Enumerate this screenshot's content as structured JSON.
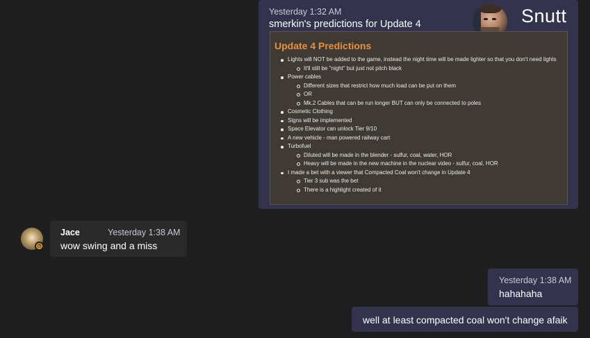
{
  "messages": {
    "main": {
      "timestamp": "Yesterday 1:32 AM",
      "text": "smerkin's predictions for Update 4",
      "image_caption": "Snutt",
      "card": {
        "title": "Update 4 Predictions",
        "items": [
          {
            "level": 1,
            "text": "Lights will NOT be added to the game, instead the night time will be made lighter so that you don't need lights"
          },
          {
            "level": 2,
            "text": "It'll still be \"night\" but just not pitch black"
          },
          {
            "level": 1,
            "text": "Power cables"
          },
          {
            "level": 2,
            "text": "Different sizes that restrict how much load can be put on them"
          },
          {
            "level": 2,
            "text": "OR"
          },
          {
            "level": 2,
            "text": "Mk.2 Cables that can be run longer BUT can only be connected to poles"
          },
          {
            "level": 1,
            "text": "Cosmetic Clothing"
          },
          {
            "level": 1,
            "text": "Signs will be implemented"
          },
          {
            "level": 1,
            "text": "Space Elevator can unlock Tier 9/10"
          },
          {
            "level": 1,
            "text": "A new vehicle - man powered railway cart"
          },
          {
            "level": 1,
            "text": "Turbofuel"
          },
          {
            "level": 2,
            "text": "Diluted will be made in the blender - sulfur, coal, water, HOR"
          },
          {
            "level": 2,
            "text": "Heavy will be made in the new machine in the nuclear video - sulfur, coal, HOR"
          },
          {
            "level": 1,
            "text": "I made a bet with a viewer that Compacted Coal won't change in Update 4"
          },
          {
            "level": 2,
            "text": "Tier 3 sub was the bet"
          },
          {
            "level": 2,
            "text": "There is a highlight created of it"
          }
        ]
      }
    },
    "jace": {
      "name": "Jace",
      "timestamp": "Yesterday 1:38 AM",
      "text": "wow swing and a miss"
    },
    "ha": {
      "timestamp": "Yesterday 1:38 AM",
      "text": "hahahaha"
    },
    "coal": {
      "text": "well at least compacted coal won't change afaik"
    }
  },
  "icons": {
    "jace_status": "clock-icon"
  },
  "colors": {
    "background": "#1f1f1f",
    "outgoing_bubble": "#33334e",
    "incoming_bubble": "#2a2a2a",
    "card_title": "#e8903a",
    "status_away": "#e8a11d"
  }
}
